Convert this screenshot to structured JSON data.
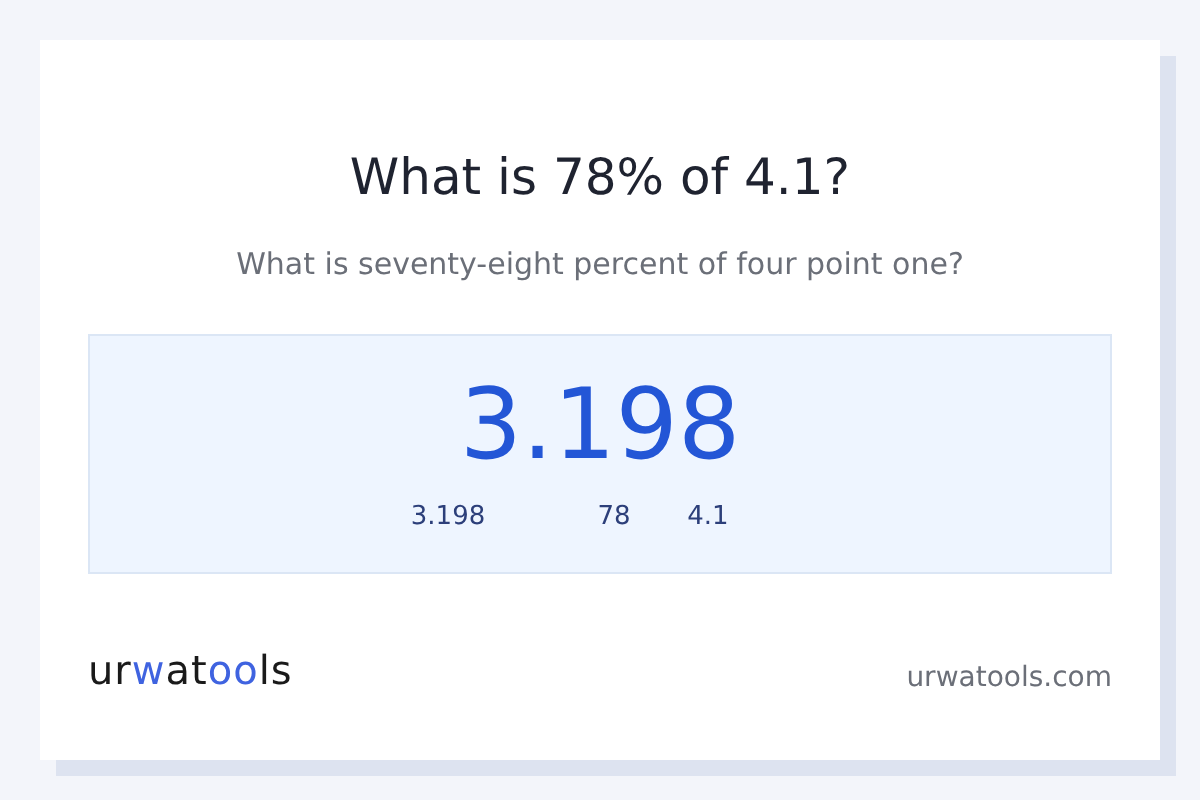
{
  "title": "What is 78% of 4.1?",
  "subtitle": "What is seventy-eight percent of four point one?",
  "result": {
    "value": "3.198",
    "terms": [
      "3.198",
      "78",
      "4.1"
    ]
  },
  "logo": [
    {
      "text": "ur",
      "accent": false
    },
    {
      "text": "w",
      "accent": true
    },
    {
      "text": "at",
      "accent": false
    },
    {
      "text": "oo",
      "accent": true
    },
    {
      "text": "ls",
      "accent": false
    }
  ],
  "site": "urwatools.com"
}
